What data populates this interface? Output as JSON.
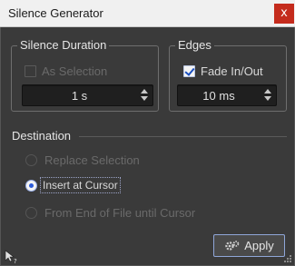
{
  "window": {
    "title": "Silence Generator",
    "close_glyph": "x"
  },
  "silence_duration": {
    "title": "Silence Duration",
    "as_selection_label": "As Selection",
    "as_selection_checked": false,
    "as_selection_enabled": false,
    "duration_value": "1 s"
  },
  "edges": {
    "title": "Edges",
    "fade_label": "Fade In/Out",
    "fade_checked": true,
    "fade_value": "10 ms"
  },
  "destination": {
    "title": "Destination",
    "options": [
      {
        "label": "Replace Selection",
        "selected": false,
        "enabled": false
      },
      {
        "label": "Insert at Cursor",
        "selected": true,
        "enabled": true
      },
      {
        "label": "From End of File until Cursor",
        "selected": false,
        "enabled": false
      }
    ]
  },
  "actions": {
    "apply_label": "Apply"
  },
  "icons": {
    "apply": "gear-icon",
    "help": "help-cursor-icon",
    "resize": "resize-grip-icon"
  },
  "colors": {
    "accent": "#2b5ad8",
    "close_bg": "#c42b1c",
    "panel_bg": "#3a3a3a"
  }
}
